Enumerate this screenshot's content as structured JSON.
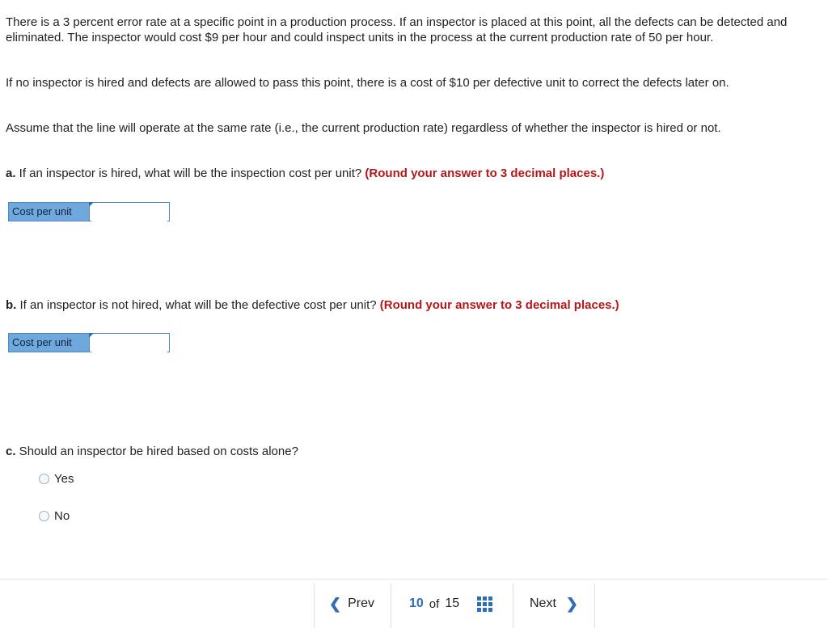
{
  "problem": {
    "p1": "There is a 3 percent error rate at a specific point in a production process. If an inspector is placed at this point, all the defects can be detected and eliminated. The inspector would cost $9 per hour and could inspect units in the process at the current production rate of 50 per hour.",
    "p2": "If no inspector is hired and defects are allowed to pass this point, there is a cost of $10 per defective unit to correct the defects later on.",
    "p3": "Assume that the line will operate at the same rate (i.e., the current production rate) regardless of whether the inspector is hired or not."
  },
  "question_a": {
    "letter": "a.",
    "text": " If an inspector is hired, what will be the inspection cost per unit? ",
    "hint": "(Round your answer to 3 decimal places.)",
    "input_label": "Cost per unit",
    "input_value": ""
  },
  "question_b": {
    "letter": "b.",
    "text": " If an inspector is not hired, what will be the defective cost per unit? ",
    "hint": "(Round your answer to 3 decimal places.)",
    "input_label": "Cost per unit",
    "input_value": ""
  },
  "question_c": {
    "letter": "c.",
    "text": " Should an inspector be hired based on costs alone?",
    "options": [
      "Yes",
      "No"
    ]
  },
  "footer": {
    "prev_label": "Prev",
    "current_page": "10",
    "of_label": "of",
    "total_pages": "15",
    "next_label": "Next"
  },
  "colors": {
    "accent": "#2f6db5",
    "hint": "#b3171a",
    "input_label_bg": "#6fa8dc"
  }
}
